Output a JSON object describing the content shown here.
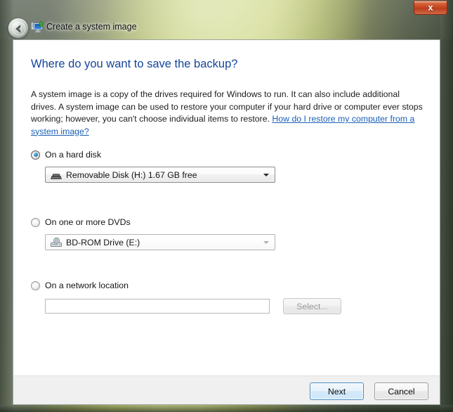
{
  "window": {
    "title": "Create a system image",
    "title_icon": "system-image-backup-icon",
    "back_icon": "back-arrow-icon",
    "close_label": "x"
  },
  "content": {
    "heading": "Where do you want to save the backup?",
    "description_part1": "A system image is a copy of the drives required for Windows to run. It can also include additional drives. A system image can be used to restore your computer if your hard drive or computer ever stops working; however, you can't choose individual items to restore. ",
    "help_link": "How do I restore my computer from a system image?"
  },
  "options": {
    "hard_disk": {
      "label": "On a hard disk",
      "selected": true,
      "combo_value": "Removable Disk (H:)  1.67 GB free",
      "combo_icon": "removable-disk-icon",
      "combo_enabled": true
    },
    "dvd": {
      "label": "On one or more DVDs",
      "selected": false,
      "combo_value": "BD-ROM Drive (E:)",
      "combo_icon": "optical-drive-icon",
      "combo_enabled": false
    },
    "network": {
      "label": "On a network location",
      "selected": false,
      "input_value": "",
      "input_placeholder": "",
      "select_label": "Select..."
    }
  },
  "footer": {
    "next_label": "Next",
    "cancel_label": "Cancel"
  },
  "colors": {
    "heading_blue": "#13459b",
    "link_blue": "#1a5fb4",
    "close_red": "#c3421d",
    "default_button_border": "#4a8ec2",
    "client_bg": "#ffffff",
    "footer_bg": "#f0f0f0"
  }
}
